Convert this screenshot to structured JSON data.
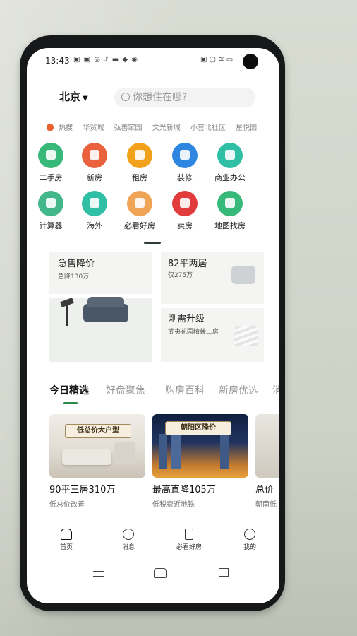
{
  "status_bar": {
    "time": "13:43",
    "left_icons": "▣ ▣ ◎ ♪ ▬ ◆ ◉",
    "right_icons": "▣ ▢ ≋ ▭"
  },
  "search": {
    "city": "北京",
    "placeholder": "你想住在哪?"
  },
  "hot_tags": [
    "热搜",
    "华贸城",
    "弘善家园",
    "文光新城",
    "小营北社区",
    "星悦园"
  ],
  "services": [
    {
      "label": "二手房",
      "color": "#37b97a"
    },
    {
      "label": "新房",
      "color": "#e9613d"
    },
    {
      "label": "租房",
      "color": "#f2a21a"
    },
    {
      "label": "装修",
      "color": "#2f86e0"
    },
    {
      "label": "商业办公",
      "color": "#2fbfa5"
    },
    {
      "label": "计算器",
      "color": "#43b78a"
    },
    {
      "label": "海外",
      "color": "#2fbfa5"
    },
    {
      "label": "必看好房",
      "color": "#f0a455"
    },
    {
      "label": "卖房",
      "color": "#e23b3b"
    },
    {
      "label": "地图找房",
      "color": "#37b97a"
    }
  ],
  "banners": {
    "a_title": "急售降价",
    "a_sub": "急降130万",
    "b_title": "82平两居",
    "b_sub": "仅275万",
    "d_title": "刚需升级",
    "d_sub": "武夷花园精装三房"
  },
  "tabs": [
    "今日精选",
    "好盘聚焦",
    "购房百科",
    "新房优选",
    "消"
  ],
  "cards": [
    {
      "ribbon": "低总价大户型",
      "title": "90平三居310万",
      "sub": "低总价改善"
    },
    {
      "ribbon": "朝阳区降价",
      "title": "最高直降105万",
      "sub": "低税费近地铁"
    },
    {
      "ribbon": "",
      "title": "总价",
      "sub": "朝南低"
    }
  ],
  "bottom_nav": [
    "首页",
    "消息",
    "必看好房",
    "我的"
  ]
}
